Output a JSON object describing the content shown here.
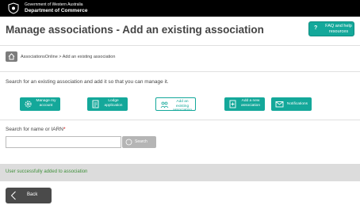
{
  "header": {
    "gov_line1": "Government of Western Australia",
    "gov_line2": "Department of Commerce",
    "crest_icon": "wa-crest-icon"
  },
  "page": {
    "title": "Manage associations - Add an existing association"
  },
  "help_button": {
    "icon": "question-icon",
    "icon_glyph": "?",
    "label": "FAQ and help resources"
  },
  "breadcrumb": {
    "home_icon": "home-icon",
    "text": "AssociationsOnline > Add an existing association"
  },
  "intro_text": "Search for an existing association and add it so that you can manage it.",
  "tiles": [
    {
      "label": "Manage my account",
      "icon": "gear-icon",
      "active": false
    },
    {
      "label": "Lodge application",
      "icon": "document-icon",
      "active": false
    },
    {
      "label": "Add an existing association",
      "icon": "people-icon",
      "active": true
    },
    {
      "label": "Add a new association",
      "icon": "add-document-icon",
      "active": false
    },
    {
      "label": "Notifications",
      "icon": "envelope-icon",
      "active": false
    }
  ],
  "search": {
    "label": "Search for name or IARN",
    "required_mark": "*",
    "value": "",
    "placeholder": "",
    "button_label": "Search",
    "button_icon": "search-icon"
  },
  "status": {
    "message": "User successfully added to association",
    "color": "#3f8f3a"
  },
  "back_button": {
    "label": "Back",
    "icon": "chevron-left-icon"
  },
  "colors": {
    "accent": "#14a89a",
    "topbar": "#000000",
    "back_button": "#4a4a4a"
  }
}
